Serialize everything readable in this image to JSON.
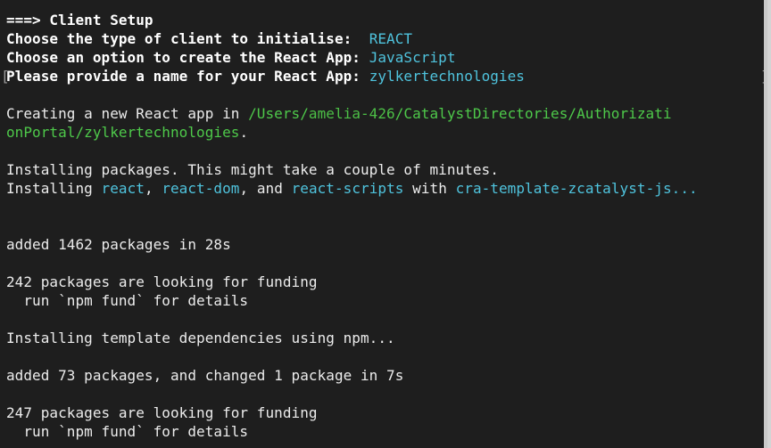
{
  "terminal": {
    "lines": {
      "l1": {
        "text": "===> Client Setup"
      },
      "l2": {
        "label": "Choose the type of client to initialise:  ",
        "value": "REACT"
      },
      "l3": {
        "label": "Choose an option to create the React App: ",
        "value": "JavaScript"
      },
      "l4": {
        "label": "Please provide a name for your React App: ",
        "value": "zylkertechnologies",
        "bracket_open": "[",
        "bracket_close": "]"
      },
      "l6": {
        "prefix": "Creating a new React app in ",
        "path_a": "/Users/",
        "path_b": "amelia-426",
        "path_c": "/CatalystDirectories/Authorizati"
      },
      "l7": {
        "path_d": "onPortal/zylkertechnologies",
        "suffix": "."
      },
      "l9": {
        "text": "Installing packages. This might take a couple of minutes."
      },
      "l10": {
        "p1": "Installing ",
        "react": "react",
        "p2": ", ",
        "react_dom": "react-dom",
        "p3": ", and ",
        "react_scripts": "react-scripts",
        "p4": " with ",
        "template": "cra-template-zcatalyst-js..."
      },
      "l13": {
        "text": "added 1462 packages in 28s"
      },
      "l15": {
        "text": "242 packages are looking for funding"
      },
      "l16": {
        "text": "  run `npm fund` for details"
      },
      "l18": {
        "text": "Installing template dependencies using npm..."
      },
      "l20": {
        "text": "added 73 packages, and changed 1 package in 7s"
      },
      "l22": {
        "text": "247 packages are looking for funding"
      },
      "l23": {
        "text": "  run `npm fund` for details"
      }
    },
    "colors": {
      "background": "#1e1e1e",
      "text": "#ececec",
      "cyan": "#4fc3dd",
      "green": "#4ec94a"
    }
  }
}
